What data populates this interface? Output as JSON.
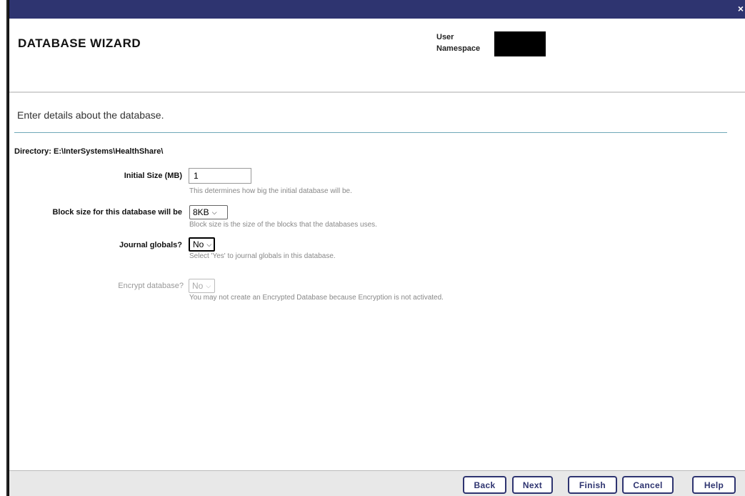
{
  "window": {
    "close_glyph": "×"
  },
  "header": {
    "title": "DATABASE WIZARD",
    "user_label": "User",
    "namespace_label": "Namespace"
  },
  "intro": "Enter details about the database.",
  "directory": "Directory: E:\\InterSystems\\HealthShare\\",
  "form": {
    "initial_size": {
      "label": "Initial Size (MB)",
      "value": "1",
      "hint": "This determines how big the initial database will be."
    },
    "block_size": {
      "label": "Block size for this database will be",
      "selected": "8KB",
      "hint": "Block size is the size of the blocks that the databases uses."
    },
    "journal_globals": {
      "label": "Journal globals?",
      "selected": "No",
      "hint": "Select 'Yes' to journal globals in this database."
    },
    "encrypt": {
      "label": "Encrypt database?",
      "selected": "No",
      "hint": "You may not create an Encrypted Database because Encryption is not activated."
    }
  },
  "buttons": {
    "back": "Back",
    "next": "Next",
    "finish": "Finish",
    "cancel": "Cancel",
    "help": "Help"
  },
  "icons": {
    "dropdown": "chevron-down-icon",
    "close": "close-icon"
  },
  "colors": {
    "titlebar": "#2e3470",
    "accent_rule": "#6fa8b8",
    "button_border": "#2e3470"
  }
}
